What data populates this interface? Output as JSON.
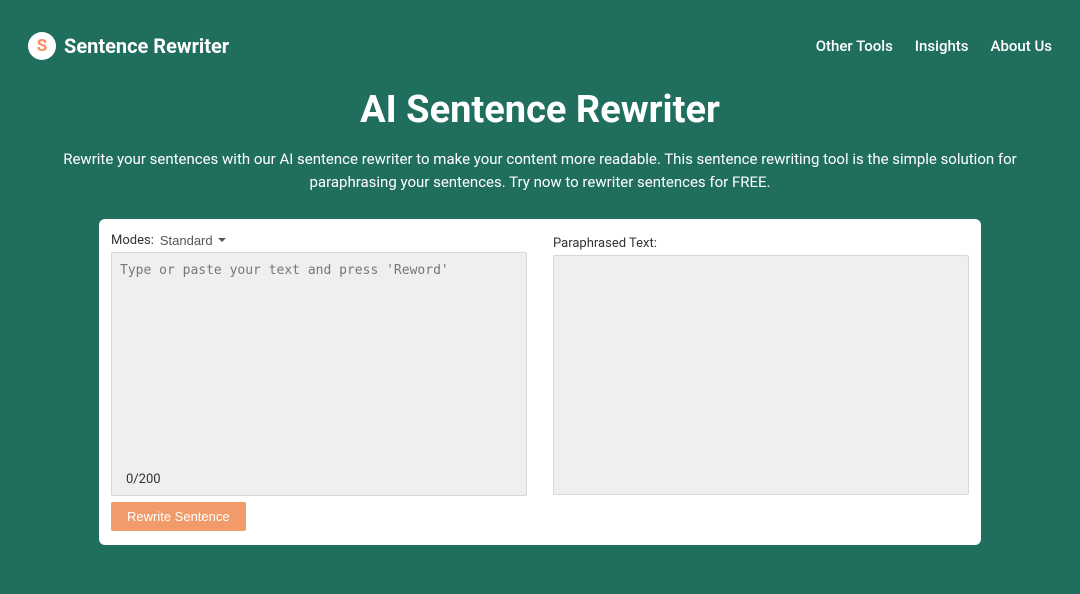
{
  "header": {
    "logo_letter": "S",
    "logo_text": "Sentence Rewriter",
    "nav": {
      "other_tools": "Other Tools",
      "insights": "Insights",
      "about_us": "About Us"
    }
  },
  "hero": {
    "title": "AI Sentence Rewriter",
    "subtitle": "Rewrite your sentences with our AI sentence rewriter to make your content more readable. This sentence rewriting tool is the simple solution for paraphrasing your sentences. Try now to rewriter sentences for FREE."
  },
  "tool": {
    "modes_label": "Modes:",
    "mode_selected": "Standard",
    "input_placeholder": "Type or paste your text and press 'Reword'",
    "counter": "0/200",
    "rewrite_button": "Rewrite Sentence",
    "output_label": "Paraphrased Text:"
  }
}
